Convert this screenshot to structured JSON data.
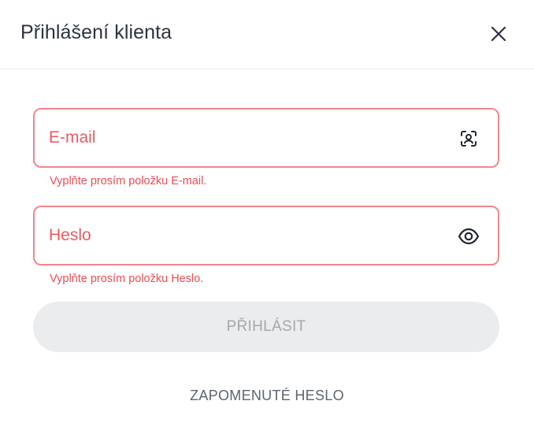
{
  "dialog": {
    "title": "Přihlášení klienta",
    "close_icon": "close-icon"
  },
  "email": {
    "placeholder": "E-mail",
    "value": "",
    "icon": "face-scan-icon",
    "error": "Vyplňte prosím položku E-mail."
  },
  "password": {
    "placeholder": "Heslo",
    "value": "",
    "icon": "eye-icon",
    "error": "Vyplňte prosím položku Heslo."
  },
  "submit": {
    "label": "PŘIHLÁSIT"
  },
  "forgot": {
    "label": "ZAPOMENUTÉ HESLO"
  },
  "colors": {
    "error": "#ef4b52",
    "error_border": "#f4868b",
    "title": "#2c3440",
    "button_bg": "#ebeced",
    "button_text": "#a3a8af",
    "link": "#5c6570"
  }
}
